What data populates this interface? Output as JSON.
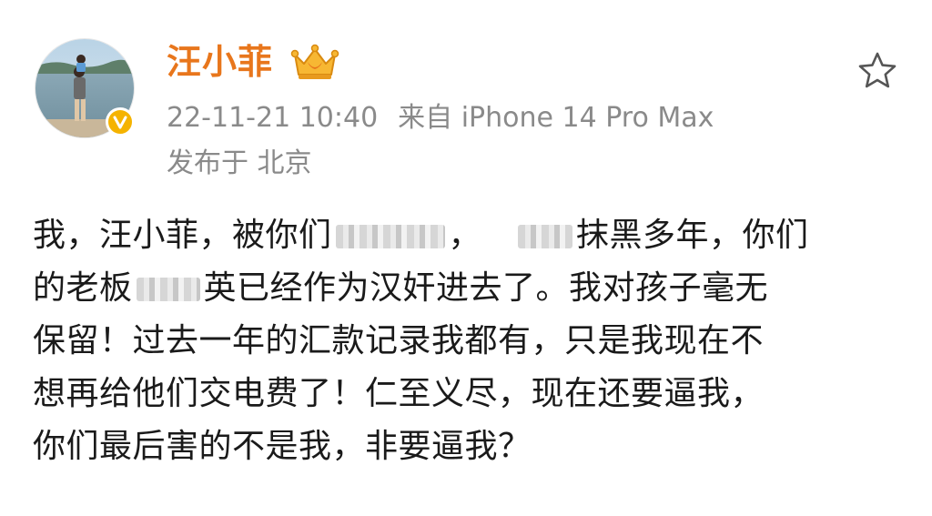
{
  "post": {
    "author": {
      "name": "汪小菲",
      "avatar_icon": "avatar-photo-icon",
      "verified_icon": "verified-badge-icon",
      "vip_icon": "crown-icon"
    },
    "timestamp": "22-11-21 10:40",
    "source": "来自 iPhone 14 Pro Max",
    "location": "发布于 北京",
    "favorite_icon": "star-icon",
    "colors": {
      "username": "#e8761c",
      "meta": "#8a8a8a",
      "badge": "#f5b300",
      "text": "#1a1a1a"
    },
    "content": {
      "line1": {
        "a": "我，汪小菲，被你们",
        "b": "，",
        "c": "抹黑多年，你们"
      },
      "line2": {
        "a": "的老板",
        "b": "英已经作为汉奸进去了。我对孩子毫无"
      },
      "line3": "保留！过去一年的汇款记录我都有，只是我现在不",
      "line4": "想再给他们交电费了！仁至义尽，现在还要逼我，",
      "line5": "你们最后害的不是我，非要逼我？"
    }
  }
}
